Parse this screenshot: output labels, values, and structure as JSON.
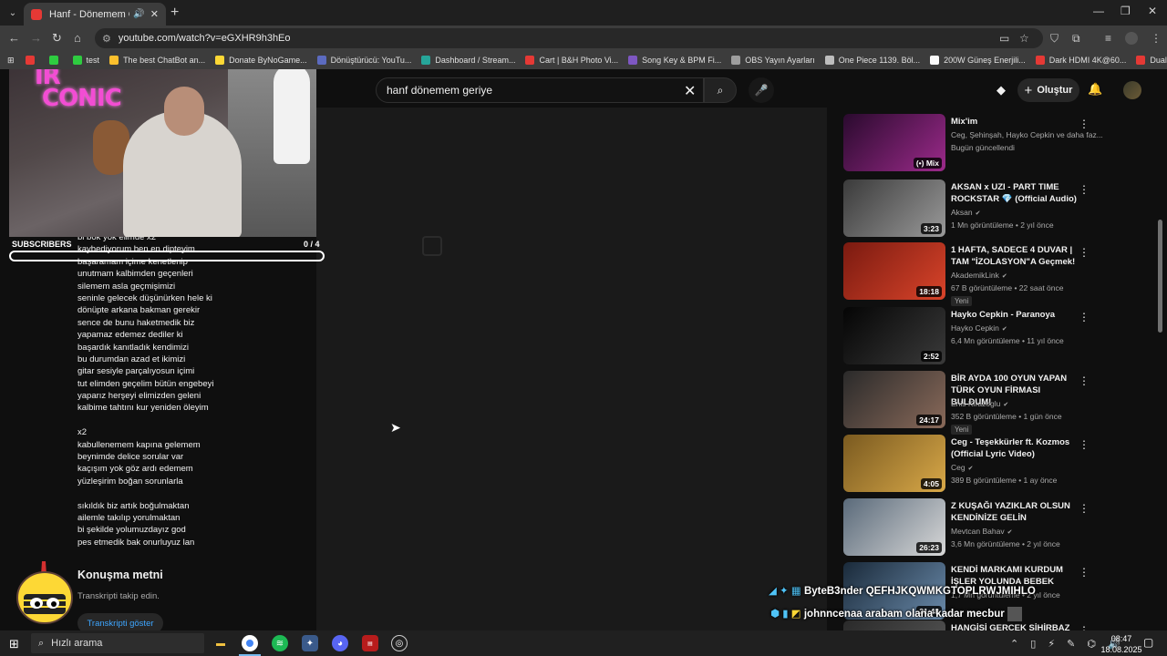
{
  "browser": {
    "tab_title": "Hanf - Dönemem Geriye - YouTube",
    "url_site_icon": "site-info-icon",
    "url": "youtube.com/watch?v=eGXHR9h3hEo",
    "bookmarks": [
      {
        "label": "",
        "color": "#e53935"
      },
      {
        "label": "",
        "color": "#2ecc40"
      },
      {
        "label": "test",
        "color": "#2ecc40"
      },
      {
        "label": "The best ChatBot an...",
        "color": "#fbc02d"
      },
      {
        "label": "Donate ByNoGame...",
        "color": "#fdd835"
      },
      {
        "label": "Dönüştürücü: YouTu...",
        "color": "#5c6bc0"
      },
      {
        "label": "Dashboard / Stream...",
        "color": "#26a69a"
      },
      {
        "label": "Cart | B&H Photo Vi...",
        "color": "#e53935"
      },
      {
        "label": "Song Key & BPM Fi...",
        "color": "#7e57c2"
      },
      {
        "label": "OBS Yayın Ayarları",
        "color": "#9e9e9e"
      },
      {
        "label": "One Piece 1139. Böl...",
        "color": "#bdbdbd"
      },
      {
        "label": "200W Güneş Enerjili...",
        "color": "#fafafa"
      },
      {
        "label": "Dark HDMI 4K@60...",
        "color": "#e53935"
      },
      {
        "label": "Dual PC Audio Setu...",
        "color": "#e53935"
      }
    ]
  },
  "youtube": {
    "search_query": "hanf dönemem geriye",
    "create_label": "Oluştur",
    "overlay": {
      "brand_line1": "IR",
      "brand_line2": "CONIC",
      "subs_label": "SUBSCRIBERS",
      "subs_count": "0 / 4"
    },
    "lyrics": [
      "bi bok yok elimde x2",
      "kaybediyorum ben en dipteyim",
      "başaramam içime kenetlenip",
      "unutmam kalbimden geçenleri",
      "silemem asla geçmişimizi",
      "seninle gelecek düşünürken hele ki",
      "dönüpte arkana bakman gerekir",
      "sence de bunu haketmedik biz",
      "yapamaz edemez dediler ki",
      "başardık kanıtladık kendimizi",
      "bu durumdan azad et ikimizi",
      "gitar sesiyle parçalıyosun içimi",
      "tut elimden geçelim bütün engebeyi",
      "yaparız herşeyi elimizden geleni",
      "kalbime tahtını kur yeniden öleyim",
      "",
      "x2",
      "kabullenemem kapına gelemem",
      "beynimde delice sorular var",
      "kaçışım yok göz ardı edemem",
      "yüzleşirim boğan sorunlarla",
      "",
      "sıkıldık biz artık boğulmaktan",
      "ailemle takılıp yorulmaktan",
      "bi şekilde yolumuzdayız god",
      "pes etmedik bak onurluyuz lan"
    ],
    "transcript": {
      "title": "Konuşma metni",
      "subtitle": "Transkripti takip edin.",
      "button": "Transkripti göster"
    },
    "recommendations": [
      {
        "title": "Mix'im",
        "channel": "Ceg, Şehinşah, Hayko Cepkin ve daha faz...",
        "meta": "Bugün güncellendi",
        "duration": "(•) Mix",
        "verified": false,
        "badge": "",
        "colors": [
          "#2a0a2e",
          "#9b2a8a"
        ]
      },
      {
        "title": "AKSAN x UZI - PART TIME ROCKSTAR 💎 (Official Audio)",
        "channel": "Aksan",
        "meta": "1 Mn görüntüleme • 2 yıl önce",
        "duration": "3:23",
        "verified": true,
        "badge": "",
        "colors": [
          "#3a3a3a",
          "#9a9a9a"
        ]
      },
      {
        "title": "1 HAFTA, SADECE 4 DUVAR | TAM \"İZOLASYON\"A Geçmek!",
        "channel": "AkademikLink",
        "meta": "67 B görüntüleme • 22 saat önce",
        "duration": "18:18",
        "verified": true,
        "badge": "Yeni",
        "colors": [
          "#7a1a10",
          "#d9442a"
        ]
      },
      {
        "title": "Hayko Cepkin - Paranoya",
        "channel": "Hayko Cepkin",
        "meta": "6,4 Mn görüntüleme • 11 yıl önce",
        "duration": "2:52",
        "verified": true,
        "badge": "",
        "colors": [
          "#050505",
          "#3a3a3a"
        ]
      },
      {
        "title": "BİR AYDA 100 OYUN YAPAN TÜRK OYUN FİRMASI BULDUM!",
        "channel": "Enis Kirazoglu",
        "meta": "352 B görüntüleme • 1 gün önce",
        "duration": "24:17",
        "verified": true,
        "badge": "Yeni",
        "colors": [
          "#2a2a2a",
          "#8a6a5a"
        ]
      },
      {
        "title": "Ceg - Teşekkürler ft. Kozmos (Official Lyric Video)",
        "channel": "Ceg",
        "meta": "389 B görüntüleme • 1 ay önce",
        "duration": "4:05",
        "verified": true,
        "badge": "",
        "colors": [
          "#7a5a20",
          "#d8a848"
        ]
      },
      {
        "title": "Z KUŞAĞI YAZIKLAR OLSUN KENDİNİZE GELİN",
        "channel": "Mevtcan Bahav",
        "meta": "3,6 Mn görüntüleme • 2 yıl önce",
        "duration": "26:23",
        "verified": true,
        "badge": "",
        "colors": [
          "#5a6a7a",
          "#d8d8d8"
        ]
      },
      {
        "title": "KENDİ MARKAMI KURDUM İŞLER YOLUNDA BEBEK",
        "channel": "",
        "meta": "1,7 Mn görüntüleme • 2 yıl önce",
        "duration": "21:48",
        "verified": false,
        "badge": "",
        "colors": [
          "#1a2a3a",
          "#6a8aaa"
        ]
      },
      {
        "title": "HANGİSİ GERÇEK SİHİRBAZ ? -",
        "channel": "",
        "meta": "",
        "duration": "",
        "verified": false,
        "badge": "",
        "colors": [
          "#2a2a2a",
          "#5a5a5a"
        ]
      }
    ],
    "chat": [
      {
        "user": "ByteB3nder",
        "message": "QEFHJKQWMKGTOPLRWJMIHLO",
        "user_color": "#ffffff"
      },
      {
        "user": "johnncenaa",
        "message": "arabam olana kadar mecbur",
        "user_color": "#ffffff"
      }
    ]
  },
  "taskbar": {
    "search_placeholder": "Hızlı arama",
    "time": "08:47",
    "date": "18.08.2025"
  }
}
